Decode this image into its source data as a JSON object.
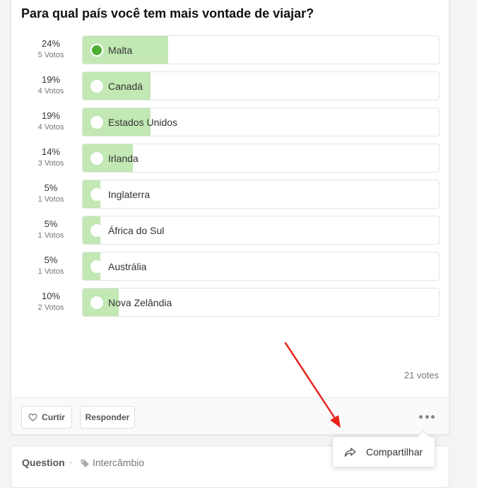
{
  "poll": {
    "title": "Para qual país você tem mais vontade de viajar?",
    "options": [
      {
        "label": "Malta",
        "percent_text": "24%",
        "votes_text": "5 Votos",
        "percent": 24,
        "selected": true
      },
      {
        "label": "Canadá",
        "percent_text": "19%",
        "votes_text": "4 Votos",
        "percent": 19,
        "selected": false
      },
      {
        "label": "Estados Unidos",
        "percent_text": "19%",
        "votes_text": "4 Votos",
        "percent": 19,
        "selected": false
      },
      {
        "label": "Irlanda",
        "percent_text": "14%",
        "votes_text": "3 Votos",
        "percent": 14,
        "selected": false
      },
      {
        "label": "Inglaterra",
        "percent_text": "5%",
        "votes_text": "1 Votos",
        "percent": 5,
        "selected": false
      },
      {
        "label": "África do Sul",
        "percent_text": "5%",
        "votes_text": "1 Votos",
        "percent": 5,
        "selected": false
      },
      {
        "label": "Austrália",
        "percent_text": "5%",
        "votes_text": "1 Votos",
        "percent": 5,
        "selected": false
      },
      {
        "label": "Nova Zelândia",
        "percent_text": "10%",
        "votes_text": "2 Votos",
        "percent": 10,
        "selected": false
      }
    ],
    "total_votes": "21 votes"
  },
  "actions": {
    "like_label": "Curtir",
    "reply_label": "Responder"
  },
  "menu": {
    "share_label": "Compartilhar"
  },
  "next_post": {
    "type": "Question",
    "separator": "·",
    "tag": "Intercâmbio"
  },
  "colors": {
    "bar_fill": "#c2e8b3",
    "selected_radio": "#4caf32",
    "annotation_arrow": "#e8231c"
  },
  "icons": [
    "heart-icon",
    "more-dots-icon",
    "share-icon",
    "tag-icon"
  ]
}
